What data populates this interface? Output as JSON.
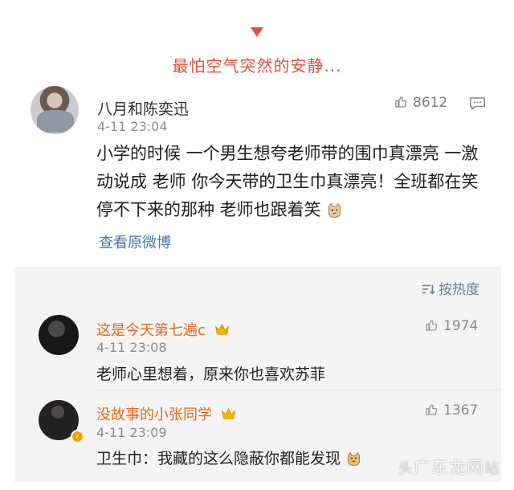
{
  "header": {
    "text": "最怕空气突然的安静..."
  },
  "main_post": {
    "username": "八月和陈奕迅",
    "time": "4-11 23:04",
    "likes": "8612",
    "content": "小学的时候 一个男生想夸老师带的围巾真漂亮 一激动说成 老师 你今天带的卫生巾真漂亮！全班都在笑 停不下来的那种 老师也跟着笑",
    "view_original": "查看原微博"
  },
  "comments_section": {
    "sort_label": "按热度",
    "comments": [
      {
        "username": "这是今天第七遍c",
        "time": "4-11 23:08",
        "likes": "1974",
        "text": "老师心里想着，原来你也喜欢苏菲"
      },
      {
        "username": "没故事的小张同学",
        "time": "4-11 23:09",
        "likes": "1367",
        "text": "卫生巾：我藏的这么隐蔽你都能发现"
      }
    ]
  },
  "watermark": {
    "prefix": "头",
    "main": "广东龙网",
    "suffix": "站"
  },
  "colors": {
    "accent": "#e0523d",
    "username_comment": "#e46a1b",
    "link": "#4a76a8",
    "comment_background": "#f4f4f4"
  }
}
